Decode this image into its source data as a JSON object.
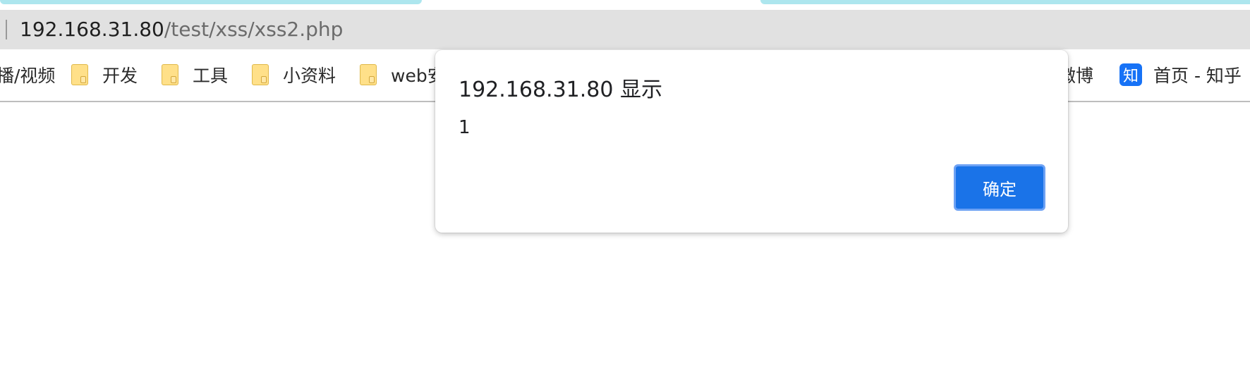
{
  "address_bar": {
    "host": "192.168.31.80",
    "path": "/test/xss/xss2.php"
  },
  "bookmarks": [
    {
      "label": "播/视频",
      "icon": "none"
    },
    {
      "label": "开发",
      "icon": "folder-icon"
    },
    {
      "label": "工具",
      "icon": "folder-icon"
    },
    {
      "label": "小资料",
      "icon": "folder-icon"
    },
    {
      "label": "web安",
      "icon": "folder-icon"
    },
    {
      "label": "微博",
      "icon": "none"
    },
    {
      "label": "首页 - 知乎",
      "icon": "zhihu-icon",
      "icon_text": "知"
    }
  ],
  "dialog": {
    "title": "192.168.31.80 显示",
    "message": "1",
    "ok_label": "确定"
  },
  "colors": {
    "accent": "#1a73e8",
    "tab_sliver": "#ade6ee",
    "address_bar_bg": "#e1e1e1"
  }
}
